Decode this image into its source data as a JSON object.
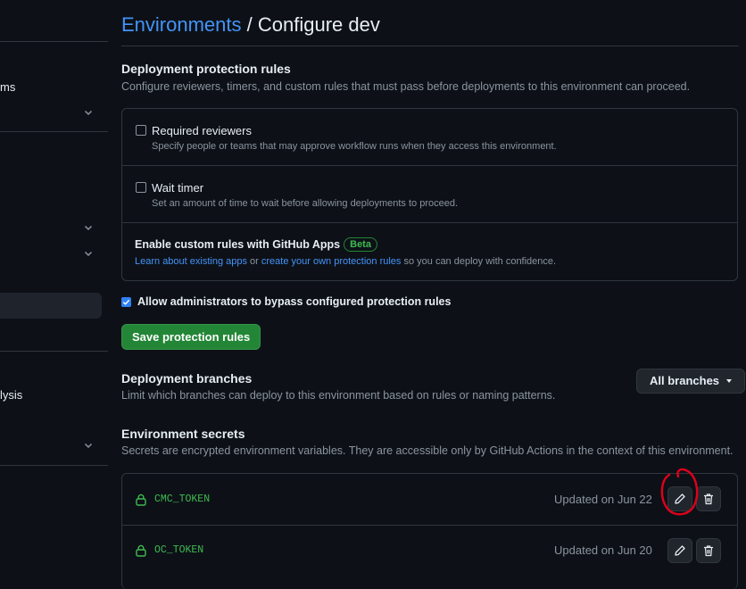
{
  "sidebar": {
    "fragment_1": "ms",
    "fragment_2": "lysis"
  },
  "header": {
    "breadcrumb_link": "Environments",
    "separator": "/",
    "page_title": "Configure dev"
  },
  "protection": {
    "heading": "Deployment protection rules",
    "description": "Configure reviewers, timers, and custom rules that must pass before deployments to this environment can proceed.",
    "rules": [
      {
        "title": "Required reviewers",
        "description": "Specify people or teams that may approve workflow runs when they access this environment.",
        "checked": false
      },
      {
        "title": "Wait timer",
        "description": "Set an amount of time to wait before allowing deployments to proceed.",
        "checked": false
      }
    ],
    "custom": {
      "title": "Enable custom rules with GitHub Apps",
      "badge": "Beta",
      "link1": "Learn about existing apps",
      "text_or": " or ",
      "link2": "create your own protection rules",
      "text_end": " so you can deploy with confidence."
    },
    "bypass_label": "Allow administrators to bypass configured protection rules",
    "bypass_checked": true,
    "save_button": "Save protection rules"
  },
  "branches": {
    "heading": "Deployment branches",
    "description": "Limit which branches can deploy to this environment based on rules or naming patterns.",
    "dropdown_value": "All branches"
  },
  "secrets": {
    "heading": "Environment secrets",
    "description": "Secrets are encrypted environment variables. They are accessible only by GitHub Actions in the context of this environment.",
    "items": [
      {
        "name": "CMC_TOKEN",
        "updated": "Updated on Jun 22"
      },
      {
        "name": "OC_TOKEN",
        "updated": "Updated on Jun 20"
      }
    ]
  },
  "colors": {
    "background": "#0d1117",
    "link": "#4493f8",
    "green": "#238636",
    "secret_name": "#3fb950",
    "annotation": "#e0001b"
  },
  "icons": [
    "chevron-down-icon",
    "lock-icon",
    "pencil-icon",
    "trash-icon",
    "check-icon"
  ]
}
